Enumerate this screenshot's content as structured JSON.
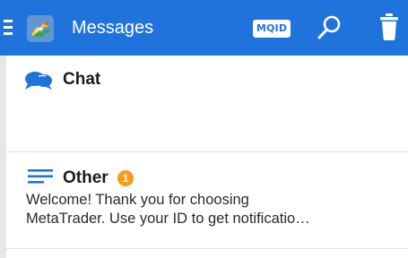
{
  "app_bar": {
    "title": "Messages",
    "mqid_label": "MQID",
    "background_color": "#1f73db",
    "menu_icon": "hamburger-menu-icon",
    "logo_icon": "metatrader-logo-icon",
    "search_icon": "search-icon",
    "delete_icon": "trash-icon"
  },
  "rows": [
    {
      "title": "Chat",
      "icon": "chat-bubbles-icon",
      "icon_color": "#1f73db"
    },
    {
      "title": "Other",
      "icon": "lines-icon",
      "icon_color": "#1f73db",
      "badge": "1",
      "badge_color": "#f39c1e",
      "preview_line_1": "Welcome! Thank you for choosing",
      "preview_line_2": "MetaTrader. Use your ID to get notificatio…"
    }
  ]
}
